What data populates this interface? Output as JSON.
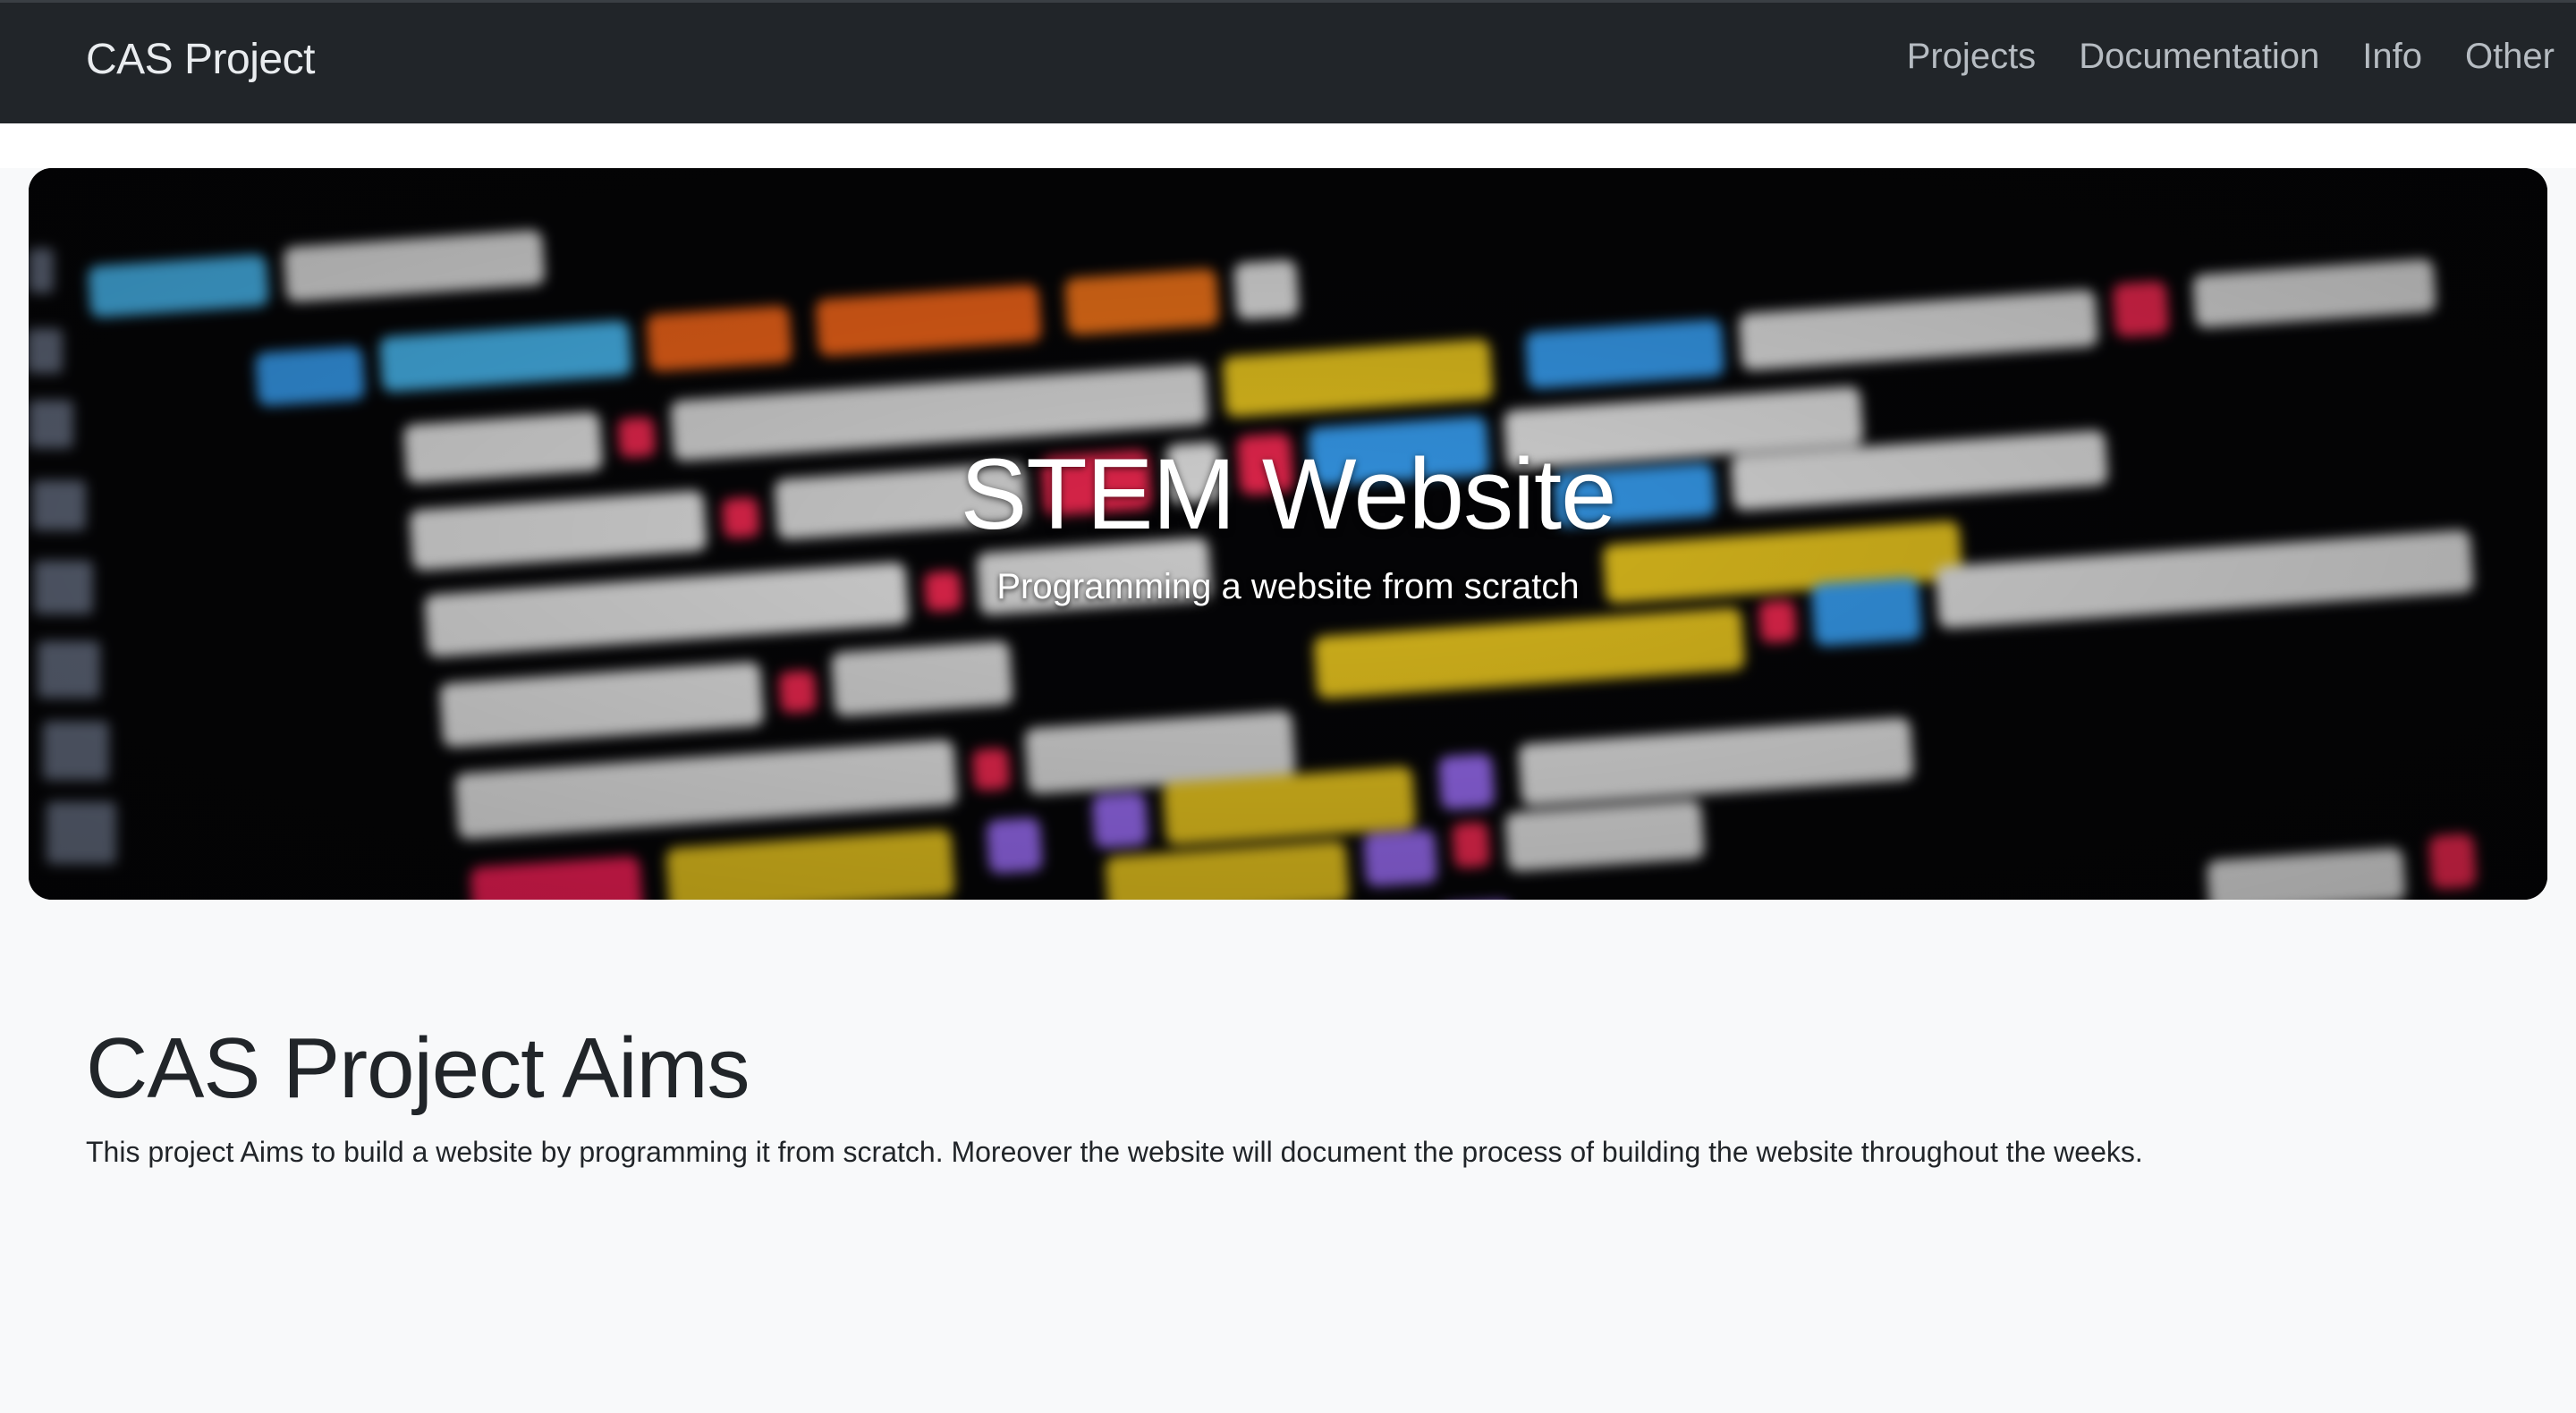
{
  "navbar": {
    "brand": "CAS Project",
    "links": [
      {
        "label": "Projects"
      },
      {
        "label": "Documentation"
      },
      {
        "label": "Info"
      },
      {
        "label": "Other"
      }
    ]
  },
  "hero": {
    "title": "STEM Website",
    "subtitle": "Programming a website from scratch",
    "background": "blurred-code-image"
  },
  "aims": {
    "heading": "CAS Project Aims",
    "text": "This project Aims to build a website by programming it from scratch. Moreover the website will document the process of building the website throughout the weeks."
  },
  "colors": {
    "navbar_bg": "#212529",
    "page_bg": "#f8f9fa",
    "hero_text": "#ffffff"
  }
}
